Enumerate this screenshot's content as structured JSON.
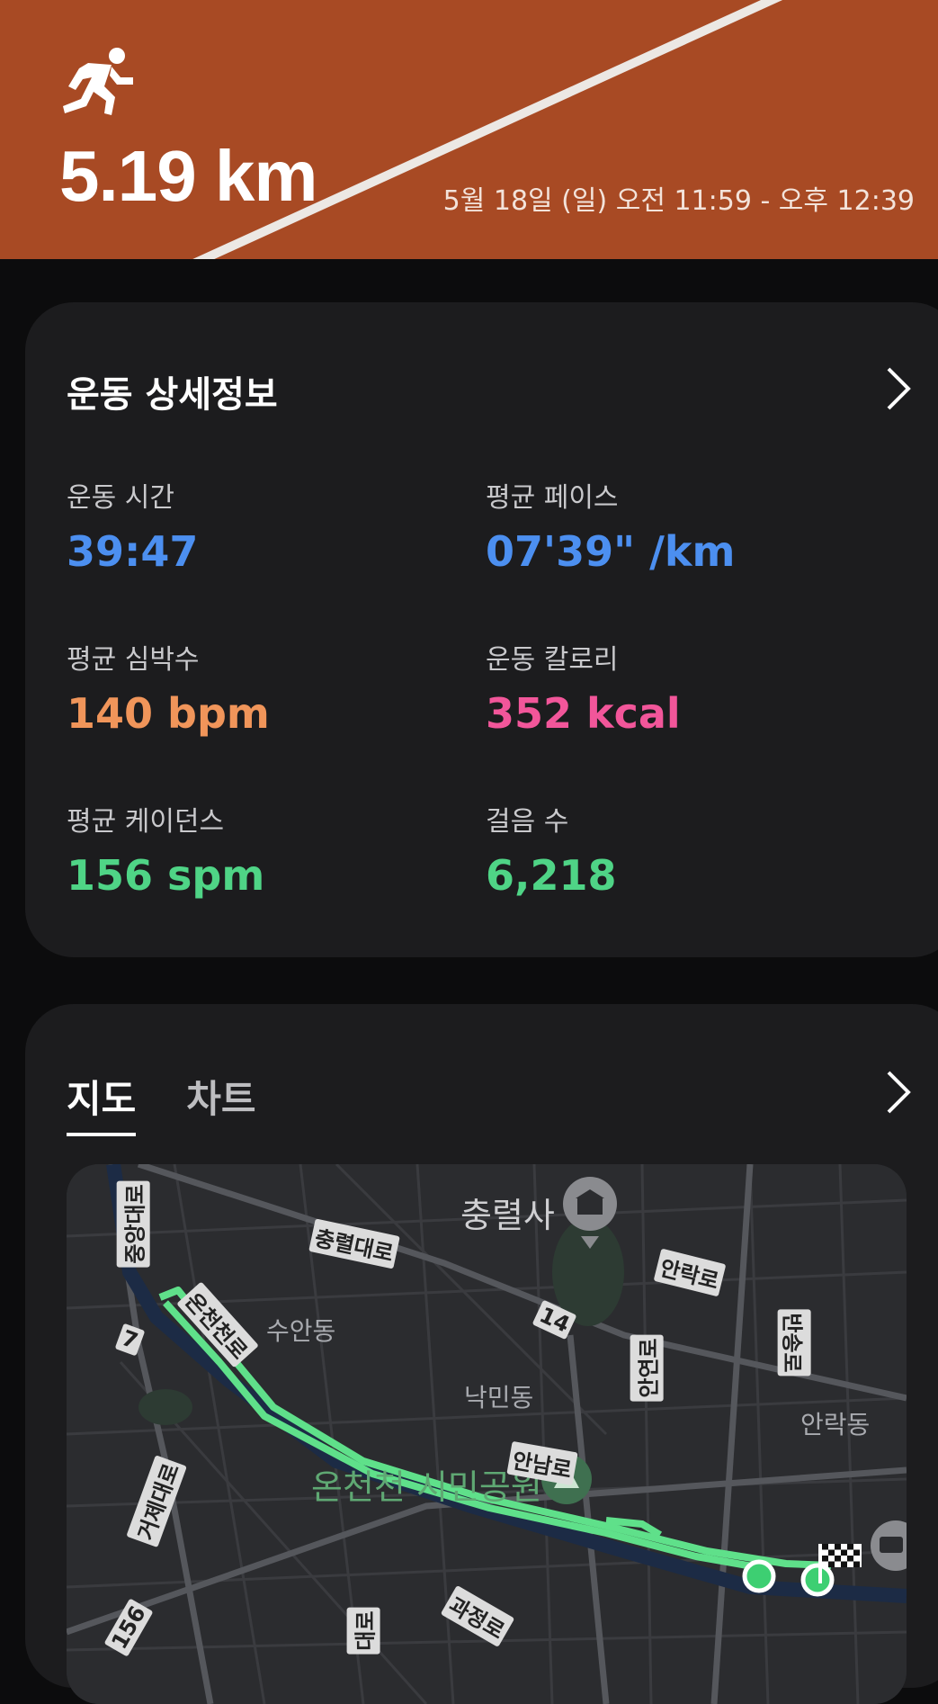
{
  "header": {
    "distance": "5.19 km",
    "datetime": "5월 18일 (일) 오전 11:59 - 오후 12:39",
    "activity_icon": "running-icon"
  },
  "details": {
    "title": "운동 상세정보",
    "stats": [
      {
        "label": "운동 시간",
        "value": "39:47",
        "color": "#4c8ff0"
      },
      {
        "label": "평균 페이스",
        "value": "07'39\" /km",
        "color": "#4c8ff0"
      },
      {
        "label": "평균 심박수",
        "value": "140 bpm",
        "color": "#f0955a"
      },
      {
        "label": "운동 칼로리",
        "value": "352 kcal",
        "color": "#f2569a"
      },
      {
        "label": "평균 케이던스",
        "value": "156 spm",
        "color": "#4fd486"
      },
      {
        "label": "걸음 수",
        "value": "6,218",
        "color": "#4fd486"
      }
    ]
  },
  "map_card": {
    "tabs": [
      "지도",
      "차트"
    ],
    "active_tab": "지도",
    "labels": {
      "poi": "충렬사",
      "park": "온천천 시민공원",
      "sujeon": "수안동",
      "nakmin": "낙민동",
      "anrak_dong": "안락동",
      "road_central": "중앙대로",
      "road_chungnyeol": "충렬대로",
      "road_oncheon": "온천천로",
      "road_anrak": "안락로",
      "road_14": "14",
      "road_7": "7",
      "road_bansong": "반송로",
      "road_anheon": "안연로",
      "road_annam": "안남로",
      "road_geoje": "거제대로",
      "road_gwajeong": "과정로",
      "road_bottom": "대로",
      "road_156": "156"
    },
    "route_color": "#5fe08a"
  }
}
